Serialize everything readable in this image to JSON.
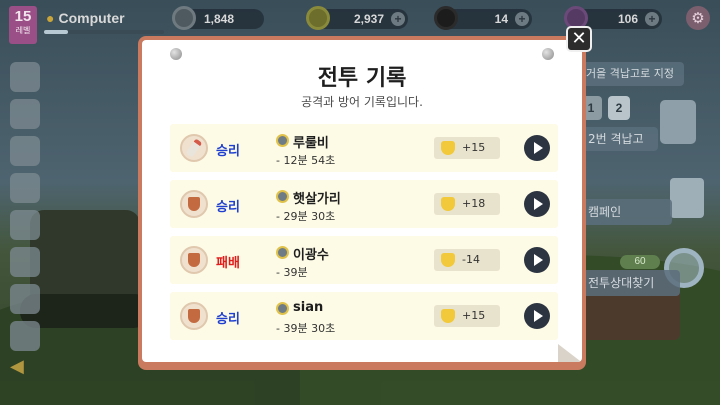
{
  "hud": {
    "level": "15",
    "level_label": "레벨",
    "player_name": "Computer",
    "xp_progress": 0.2,
    "trophies": "1,848",
    "gold": "2,937",
    "ammo": "14",
    "gems": "106"
  },
  "right_panel": {
    "destination_label": "거을 격납고로 지정",
    "slots": [
      "1",
      "2"
    ],
    "hangar_label": "2번 격납고",
    "campaign_label": "캠페인",
    "search_cost": "60",
    "search_label": "전투상대찾기"
  },
  "modal": {
    "title": "전투 기록",
    "subtitle": "공격과 방어 기록입니다.",
    "close_label": "✕",
    "records": [
      {
        "result": "승리",
        "outcome": "win",
        "emblem": "pencil-icon",
        "opponent": "루룰비",
        "duration": "- 12분 54초",
        "score_change": "+15"
      },
      {
        "result": "승리",
        "outcome": "win",
        "emblem": "shield-icon",
        "opponent": "햇살가리",
        "duration": "- 29분 30초",
        "score_change": "+18"
      },
      {
        "result": "패배",
        "outcome": "lose",
        "emblem": "shield-icon",
        "opponent": "이광수",
        "duration": "- 39분",
        "score_change": "-14"
      },
      {
        "result": "승리",
        "outcome": "win",
        "emblem": "shield-icon",
        "opponent": "sian",
        "duration": "- 39분 30초",
        "score_change": "+15"
      }
    ]
  },
  "colors": {
    "win": "#1f3fd0",
    "lose": "#e11c1c",
    "modal_frame": "#c97a5f",
    "row_bg": "#fdfbe6"
  }
}
